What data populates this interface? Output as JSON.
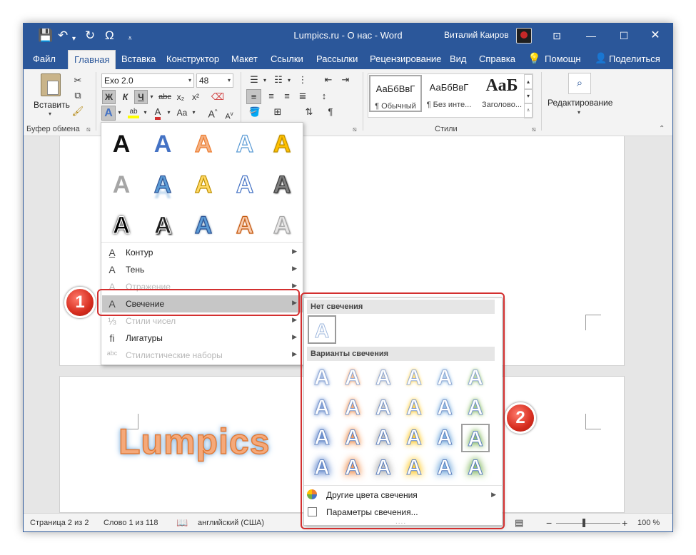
{
  "window": {
    "title": "Lumpics.ru - О нас - Word",
    "user": "Виталий Каиров",
    "quick_access": [
      "save-icon",
      "undo-icon",
      "redo-icon",
      "symbol-icon",
      "customize-icon"
    ],
    "controls": [
      "ribbon-display-icon",
      "minimize-icon",
      "maximize-icon",
      "close-icon"
    ],
    "accent": "#2b579a"
  },
  "tabs": [
    {
      "label": "Файл"
    },
    {
      "label": "Главная",
      "active": true
    },
    {
      "label": "Вставка"
    },
    {
      "label": "Конструктор"
    },
    {
      "label": "Макет"
    },
    {
      "label": "Ссылки"
    },
    {
      "label": "Рассылки"
    },
    {
      "label": "Рецензирование"
    },
    {
      "label": "Вид"
    },
    {
      "label": "Справка"
    },
    {
      "label": "Помощн"
    },
    {
      "label": "Поделиться"
    }
  ],
  "ribbon": {
    "clipboard": {
      "paste_label": "Вставить",
      "group_label": "Буфер обмена"
    },
    "font": {
      "name": "Exo 2.0",
      "size": "48",
      "bold": "Ж",
      "italic": "К",
      "underline": "Ч",
      "strike": "abc",
      "sub": "x₂",
      "sup": "x²",
      "color_a": "A",
      "case": "Aa",
      "grow": "A",
      "shrink": "A"
    },
    "styles": {
      "items": [
        {
          "sample": "АаБбВвГ",
          "name": "¶ Обычный"
        },
        {
          "sample": "АаБбВвГ",
          "name": "¶ Без инте..."
        },
        {
          "sample": "АаБ",
          "name": "Заголово..."
        }
      ],
      "group_label": "Стили"
    },
    "editing": {
      "label": "Редактирование"
    }
  },
  "text_effects": {
    "colors": {
      "row1": [
        "#111111",
        "#4472c4",
        "#f4b183",
        "#ffffff",
        "#ffc000"
      ],
      "row2": [
        "#a6a6a6",
        "#5b9bd5",
        "#ffd966",
        "#ffffff",
        "#7f7f7f"
      ],
      "row3": [
        "#000000",
        "#1f1f1f",
        "#5b9bd5",
        "#f8cbad",
        "#e7e6e6"
      ]
    },
    "menu": [
      {
        "label": "Контур",
        "icon": "outline-icon",
        "disabled": false,
        "highlighted": false
      },
      {
        "label": "Тень",
        "icon": "shadow-icon",
        "disabled": false,
        "highlighted": false
      },
      {
        "label": "Отражение",
        "icon": "reflection-icon",
        "disabled": true,
        "highlighted": false
      },
      {
        "label": "Свечение",
        "icon": "glow-icon",
        "disabled": false,
        "highlighted": true
      },
      {
        "label": "Стили чисел",
        "icon": "number-styles-icon",
        "disabled": true,
        "highlighted": false
      },
      {
        "label": "Лигатуры",
        "icon": "ligatures-icon",
        "disabled": false,
        "highlighted": false
      },
      {
        "label": "Стилистические наборы",
        "icon": "stylistic-sets-icon",
        "disabled": true,
        "highlighted": false
      }
    ]
  },
  "glow_menu": {
    "no_glow_header": "Нет свечения",
    "variants_header": "Варианты свечения",
    "glow_colors": [
      "#4472c4",
      "#ed7d31",
      "#a5a5a5",
      "#ffc000",
      "#5b9bd5",
      "#70ad47"
    ],
    "rows": 4,
    "selected": {
      "row": 2,
      "col": 5
    },
    "more_colors": "Другие цвета свечения",
    "options": "Параметры свечения..."
  },
  "document": {
    "heading_word": "Lumpics"
  },
  "status": {
    "page": "Страница 2 из 2",
    "words": "Слово 1 из 118",
    "language": "английский (США)",
    "zoom": "100 %"
  },
  "callouts": [
    "1",
    "2"
  ]
}
